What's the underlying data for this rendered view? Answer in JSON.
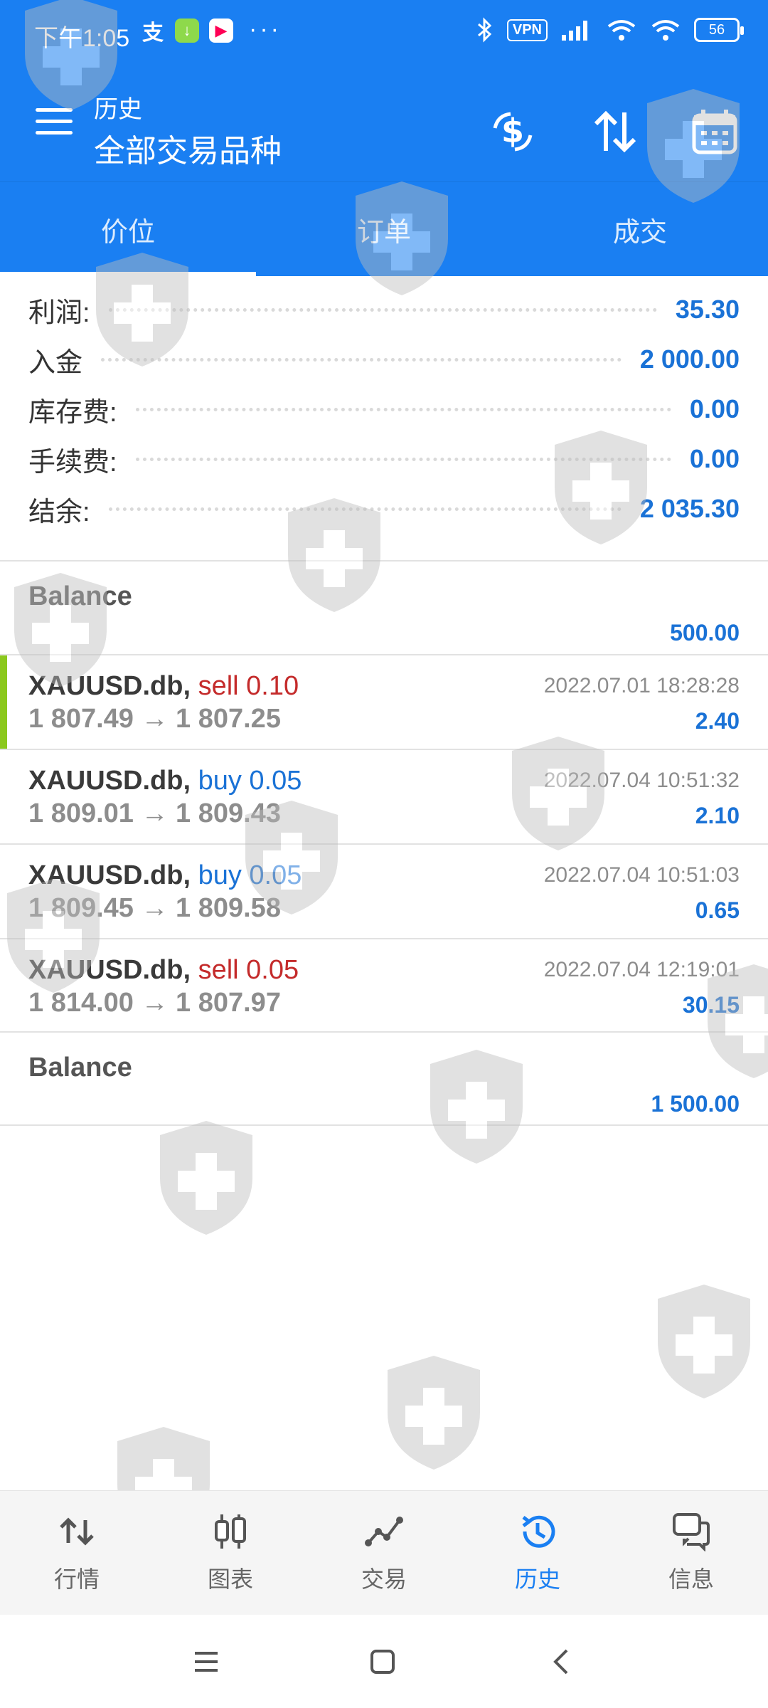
{
  "status_bar": {
    "time": "下午1:05",
    "vpn": "VPN",
    "battery": "56",
    "more": "···"
  },
  "header": {
    "subtitle": "历史",
    "title": "全部交易品种",
    "icons": [
      "currency-swap-icon",
      "sort-icon",
      "calendar-icon"
    ]
  },
  "tabs": [
    {
      "label": "价位",
      "active": true
    },
    {
      "label": "订单",
      "active": false
    },
    {
      "label": "成交",
      "active": false
    }
  ],
  "summary": [
    {
      "label": "利润:",
      "value": "35.30"
    },
    {
      "label": "入金",
      "value": "2 000.00"
    },
    {
      "label": "库存费:",
      "value": "0.00"
    },
    {
      "label": "手续费:",
      "value": "0.00"
    },
    {
      "label": "结余:",
      "value": "2 035.30"
    }
  ],
  "balance_top": {
    "label": "Balance",
    "value": "500.00"
  },
  "deals": [
    {
      "symbol": "XAUUSD.db,",
      "side": "sell",
      "volume": "0.10",
      "prices": "1 807.49 → 1 807.25",
      "time": "2022.07.01 18:28:28",
      "profit": "2.40"
    },
    {
      "symbol": "XAUUSD.db,",
      "side": "buy",
      "volume": "0.05",
      "prices": "1 809.01 → 1 809.43",
      "time": "2022.07.04 10:51:32",
      "profit": "2.10"
    },
    {
      "symbol": "XAUUSD.db,",
      "side": "buy",
      "volume": "0.05",
      "prices": "1 809.45 → 1 809.58",
      "time": "2022.07.04 10:51:03",
      "profit": "0.65"
    },
    {
      "symbol": "XAUUSD.db,",
      "side": "sell",
      "volume": "0.05",
      "prices": "1 814.00 → 1 807.97",
      "time": "2022.07.04 12:19:01",
      "profit": "30.15"
    }
  ],
  "balance_bottom": {
    "label": "Balance",
    "value": "1 500.00"
  },
  "bottom_nav": [
    {
      "label": "行情",
      "icon": "quotes-icon",
      "active": false
    },
    {
      "label": "图表",
      "icon": "chart-icon",
      "active": false
    },
    {
      "label": "交易",
      "icon": "trade-icon",
      "active": false
    },
    {
      "label": "历史",
      "icon": "history-icon",
      "active": true
    },
    {
      "label": "信息",
      "icon": "messages-icon",
      "active": false
    }
  ],
  "colors": {
    "primary": "#1a7ff2",
    "profit": "#1a72d6",
    "sell": "#c42b2b",
    "buy": "#1a72d6",
    "marker": "#8bc81e"
  }
}
